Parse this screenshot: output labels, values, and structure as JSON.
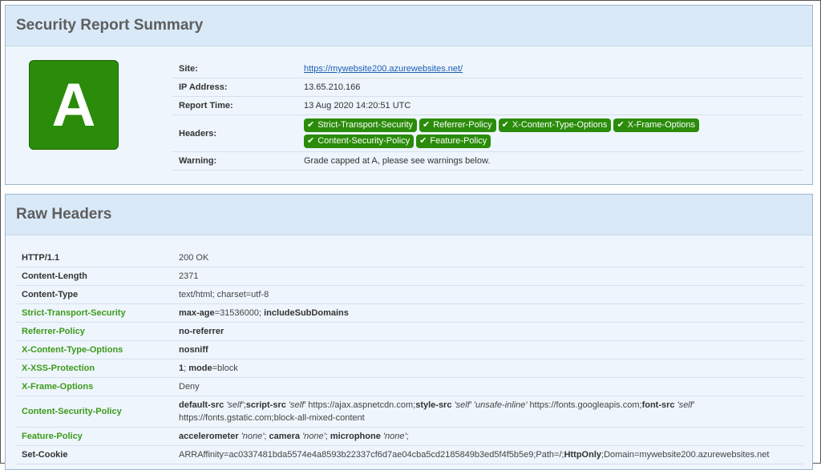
{
  "summary": {
    "title": "Security Report Summary",
    "grade": "A",
    "site_label": "Site:",
    "site_url": "https://mywebsite200.azurewebsites.net/",
    "ip_label": "IP Address:",
    "ip_value": "13.65.210.166",
    "time_label": "Report Time:",
    "time_value": "13 Aug 2020 14:20:51 UTC",
    "headers_label": "Headers:",
    "headers": [
      "Strict-Transport-Security",
      "Referrer-Policy",
      "X-Content-Type-Options",
      "X-Frame-Options",
      "Content-Security-Policy",
      "Feature-Policy"
    ],
    "warning_label": "Warning:",
    "warning_value": "Grade capped at A, please see warnings below."
  },
  "raw": {
    "title": "Raw Headers",
    "rows": [
      {
        "name": "HTTP/1.1",
        "secure": false
      },
      {
        "name": "Content-Length",
        "secure": false,
        "value": "2371"
      },
      {
        "name": "Content-Type",
        "secure": false,
        "value": "text/html; charset=utf-8"
      },
      {
        "name": "Strict-Transport-Security",
        "secure": true
      },
      {
        "name": "Referrer-Policy",
        "secure": true
      },
      {
        "name": "X-Content-Type-Options",
        "secure": true
      },
      {
        "name": "X-XSS-Protection",
        "secure": true
      },
      {
        "name": "X-Frame-Options",
        "secure": true,
        "value": "Deny"
      },
      {
        "name": "Content-Security-Policy",
        "secure": true
      },
      {
        "name": "Feature-Policy",
        "secure": true
      },
      {
        "name": "Set-Cookie",
        "secure": false
      }
    ],
    "http_value": "200 OK",
    "sts": {
      "k1": "max-age",
      "v1": "=31536000; ",
      "k2": "includeSubDomains"
    },
    "referrer": "no-referrer",
    "nosniff": "nosniff",
    "xss": {
      "k1": "1",
      "v1": "; ",
      "k2": "mode",
      "v2": "=block"
    },
    "csp": {
      "k1": "default-src",
      "i1": "'self'",
      "s1": ";",
      "k2": "script-src",
      "i2": "'self'",
      "t2": " https://ajax.aspnetcdn.com;",
      "k3": "style-src",
      "i3": "'self' 'unsafe-inline'",
      "t3": " https://fonts.googleapis.com;",
      "k4": "font-src",
      "i4": "'self'",
      "t4": "https://fonts.gstatic.com;block-all-mixed-content"
    },
    "feature": {
      "k1": "accelerometer",
      "i1": "'none'",
      "s1": "; ",
      "k2": "camera",
      "i2": "'none'",
      "s2": "; ",
      "k3": "microphone",
      "i3": "'none'",
      "s3": ";"
    },
    "cookie": {
      "t1": "ARRAffinity=ac0337481bda5574e4a8593b22337cf6d7ae04cba5cd2185849b3ed5f4f5b5e9;Path=/;",
      "k1": "HttpOnly",
      "t2": ";Domain=mywebsite200.azurewebsites.net"
    }
  }
}
